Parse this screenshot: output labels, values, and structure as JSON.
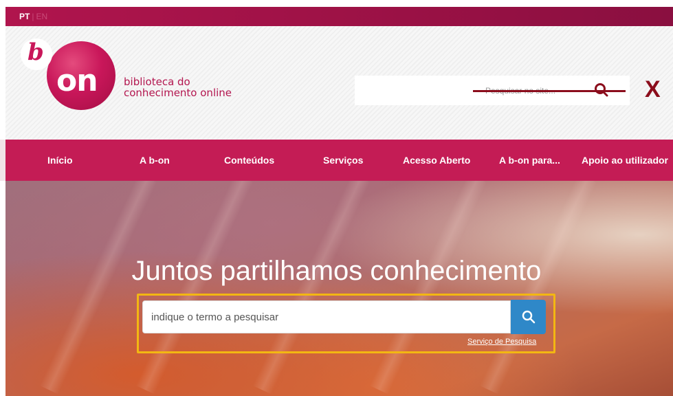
{
  "lang": {
    "pt": "PT",
    "sep": "|",
    "en": "EN"
  },
  "logo": {
    "b": "b",
    "on": "on"
  },
  "tagline": {
    "line1": "biblioteca do",
    "line2": "conhecimento online"
  },
  "site_search": {
    "placeholder": "Pesquisar no site...",
    "close": "X"
  },
  "nav": {
    "items": [
      {
        "label": "Início"
      },
      {
        "label": "A b-on"
      },
      {
        "label": "Conteúdos"
      },
      {
        "label": "Serviços"
      },
      {
        "label": "Acesso Aberto"
      },
      {
        "label": "A b-on para..."
      },
      {
        "label": "Apoio ao utilizador"
      }
    ]
  },
  "hero": {
    "title": "Juntos partilhamos conhecimento",
    "search_placeholder": "indique o termo a pesquisar",
    "service_link": "Serviço de Pesquisa"
  },
  "colors": {
    "brand": "#c41c55",
    "highlight": "#f3b712",
    "search_button": "#2f88c8",
    "strike": "#8b0d1c"
  },
  "icons": {
    "site_search": "search-icon",
    "main_search": "search-icon"
  }
}
